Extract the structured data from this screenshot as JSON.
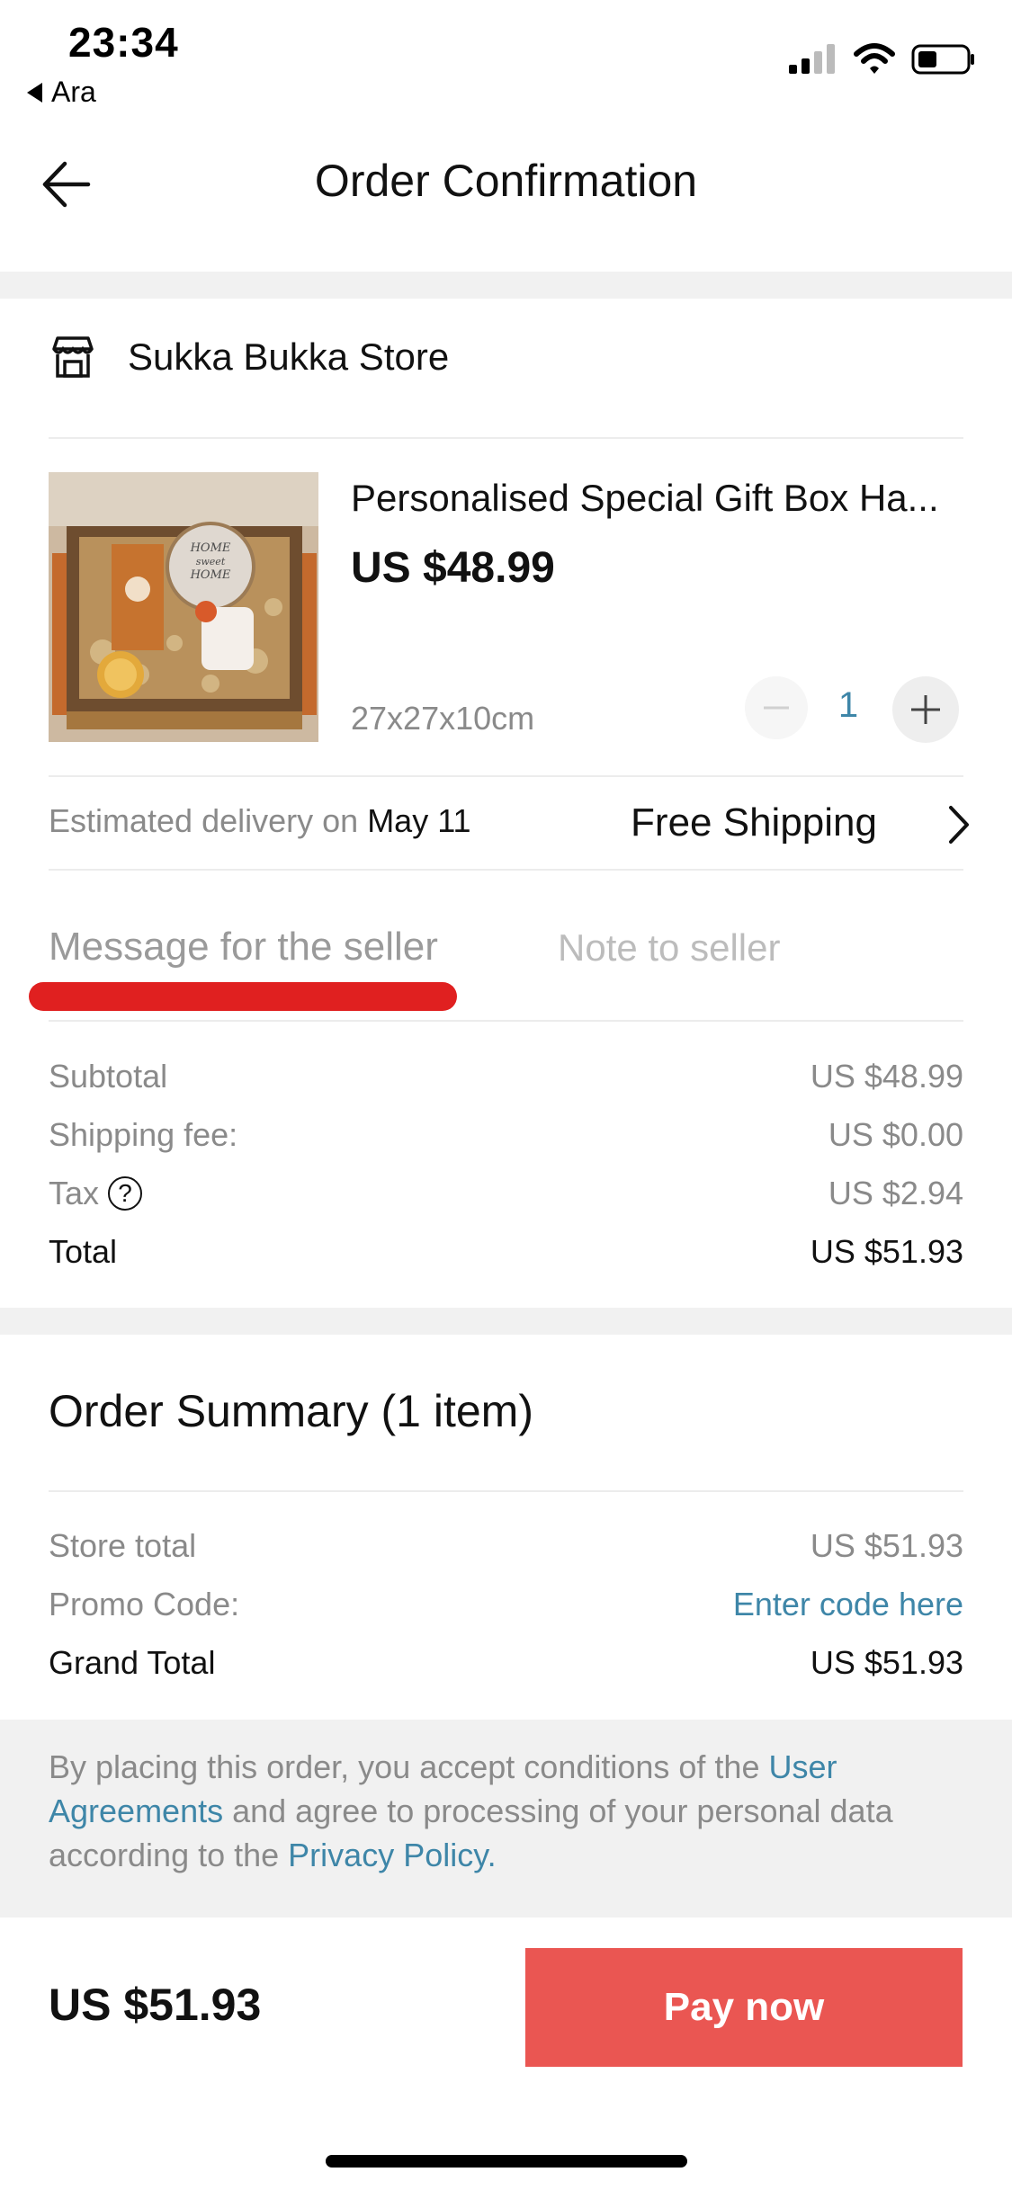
{
  "status_bar": {
    "time": "23:34",
    "back_app": "Ara"
  },
  "header": {
    "title": "Order Confirmation"
  },
  "store": {
    "name": "Sukka Bukka Store"
  },
  "product": {
    "title": "Personalised Special Gift Box Ha...",
    "price": "US $48.99",
    "variant": "27x27x10cm",
    "quantity": "1",
    "image_text": [
      "HOME",
      "sweet",
      "HOME"
    ]
  },
  "delivery": {
    "prefix": "Estimated delivery on",
    "date": "May 11",
    "shipping": "Free Shipping"
  },
  "message": {
    "label": "Message for the seller",
    "placeholder": "Note to seller"
  },
  "totals": {
    "subtotal_label": "Subtotal",
    "subtotal_value": "US $48.99",
    "shipping_label": "Shipping fee:",
    "shipping_value": "US $0.00",
    "tax_label": "Tax",
    "tax_value": "US $2.94",
    "total_label": "Total",
    "total_value": "US $51.93"
  },
  "summary": {
    "title": "Order Summary (1 item)",
    "store_total_label": "Store total",
    "store_total_value": "US $51.93",
    "promo_label": "Promo Code:",
    "promo_link": "Enter code here",
    "grand_total_label": "Grand Total",
    "grand_total_value": "US $51.93"
  },
  "legal": {
    "text1": "By placing this order, you accept conditions of the ",
    "link1": "User Agreements",
    "text2": " and agree to processing of your personal data according to the ",
    "link2": "Privacy Policy",
    "text3": "."
  },
  "bottom_bar": {
    "total": "US $51.93",
    "pay_label": "Pay now"
  },
  "colors": {
    "accent_link": "#3e86a8",
    "pay_button": "#ea5652",
    "annotation_red": "#e02020",
    "band_gray": "#f1f1f1"
  }
}
